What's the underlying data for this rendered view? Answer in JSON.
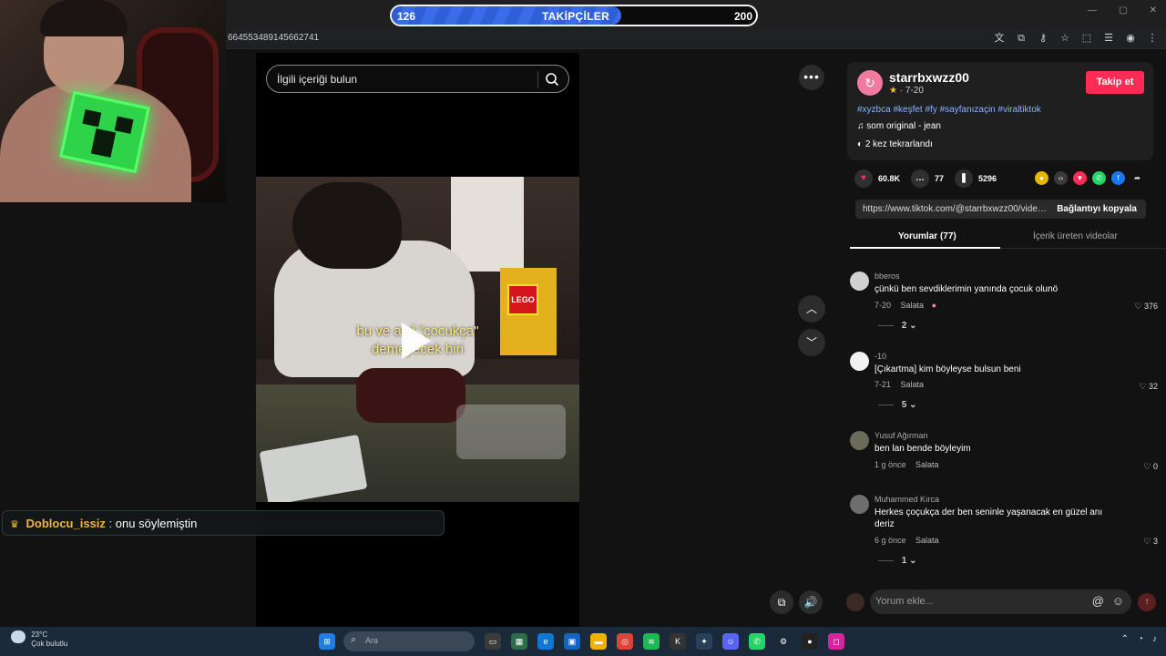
{
  "overlay": {
    "follower_goal": {
      "label": "TAKİPÇİLER",
      "current": "126",
      "target": "200",
      "progress": 0.63
    },
    "chat": {
      "user": "Doblocu_issiz",
      "separator": ":",
      "message": "onu söylemiştin"
    }
  },
  "browser": {
    "url_fragment": "664553489145662741"
  },
  "video": {
    "search_placeholder": "İlgili içeriği bulun",
    "caption_line1": "bu ve asıl \"çocukça\"",
    "caption_line2": "demeyecek biri",
    "scene_label": "LEGO"
  },
  "author": {
    "username": "starrbxwzz00",
    "date": "7-20",
    "follow_label": "Takip et",
    "hashtags": "#xyzbca #keşfet #fy #sayfanızaçin #viraltiktok",
    "sound": "som original - jean",
    "replays": "2 kez tekrarlandı"
  },
  "stats": {
    "likes": "60.8K",
    "comments": "77",
    "saves": "5296"
  },
  "share": {
    "url": "https://www.tiktok.com/@starrbxwzz00/video/...",
    "copy_label": "Bağlantıyı kopyala"
  },
  "tabs": {
    "comments": "Yorumlar (77)",
    "creator_videos": "İçerik üreten videolar"
  },
  "comments": [
    {
      "user": "bberos",
      "text": "çünkü ben sevdiklerimin yanında çocuk olunö",
      "date": "7-20",
      "reply": "Salata",
      "likes": "376",
      "replies": "2"
    },
    {
      "user": "-10",
      "text": "[Çıkartma] kim böyleyse bulsun beni",
      "date": "7-21",
      "reply": "Salata",
      "likes": "32",
      "replies": "5"
    },
    {
      "user": "Yusuf Ağırman",
      "text": "ben lan bende böyleyim",
      "date": "1 g önce",
      "reply": "Salata",
      "likes": "0"
    },
    {
      "user": "Muhammed Kırca",
      "text": "Herkes çoçukça der ben seninle yaşanacak en güzel anı deriz",
      "date": "6 g önce",
      "reply": "Salata",
      "likes": "3",
      "replies": "1"
    }
  ],
  "comment_input": {
    "placeholder": "Yorum ekle..."
  },
  "taskbar": {
    "weather_temp": "23°C",
    "weather_desc": "Çok bulutlu",
    "search_placeholder": "Ara"
  },
  "colors": {
    "accent": "#fe2c55",
    "progress": "#3a6be8",
    "chat_user": "#f2b43a",
    "hashtag": "#8ab4ff"
  }
}
